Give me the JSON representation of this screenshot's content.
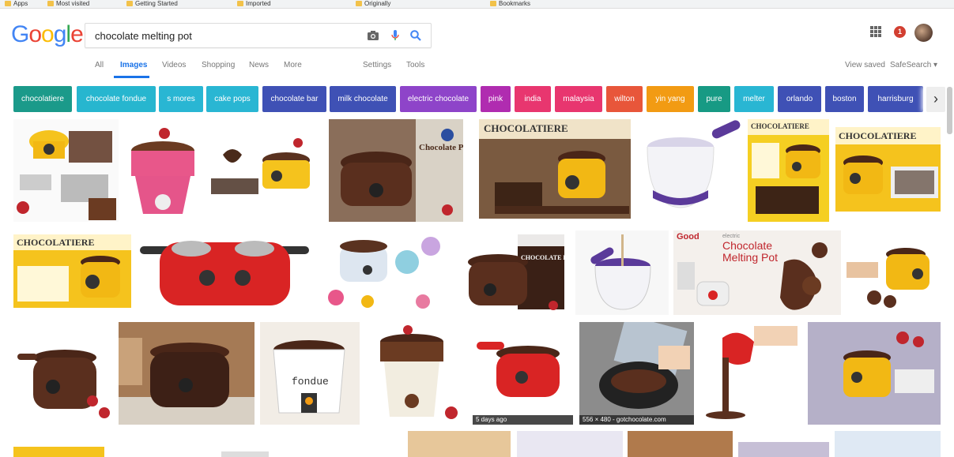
{
  "bookmarks": [
    {
      "label": "Apps"
    },
    {
      "label": "Most visited"
    },
    {
      "label": "Getting Started"
    },
    {
      "label": "Imported"
    },
    {
      "label": "Originally"
    },
    {
      "label": "Bookmarks"
    }
  ],
  "search": {
    "query": "chocolate melting pot"
  },
  "tabs": [
    {
      "label": "All"
    },
    {
      "label": "Images"
    },
    {
      "label": "Videos"
    },
    {
      "label": "Shopping"
    },
    {
      "label": "News"
    },
    {
      "label": "More"
    },
    {
      "label": "Settings"
    },
    {
      "label": "Tools"
    }
  ],
  "right_links": {
    "view_saved": "View saved",
    "safesearch": "SafeSearch ▾"
  },
  "notifications": {
    "count": "1"
  },
  "chips": [
    {
      "label": "chocolatiere",
      "color": "#1b9a8a"
    },
    {
      "label": "chocolate fondue",
      "color": "#27b6cf"
    },
    {
      "label": "s mores",
      "color": "#29b6d3"
    },
    {
      "label": "cake pops",
      "color": "#29b6d3"
    },
    {
      "label": "chocolate bar",
      "color": "#3f51b5"
    },
    {
      "label": "milk chocolate",
      "color": "#3f51b5"
    },
    {
      "label": "electric chocolate",
      "color": "#8e44c9"
    },
    {
      "label": "pink",
      "color": "#b02cb0"
    },
    {
      "label": "india",
      "color": "#e8366f"
    },
    {
      "label": "malaysia",
      "color": "#e8366f"
    },
    {
      "label": "wilton",
      "color": "#e8563a"
    },
    {
      "label": "yin yang",
      "color": "#f29b13"
    },
    {
      "label": "pure",
      "color": "#179a84"
    },
    {
      "label": "melter",
      "color": "#29b6d3"
    },
    {
      "label": "orlando",
      "color": "#3f51b5"
    },
    {
      "label": "boston",
      "color": "#3f51b5"
    },
    {
      "label": "harrisburg",
      "color": "#3f51b5"
    }
  ],
  "results": {
    "row1": [
      {
        "brand": ""
      },
      {
        "brand": ""
      },
      {
        "brand": ""
      },
      {
        "brand": "Chocolate Pro"
      },
      {
        "brand": "CHOCOLATIERE"
      },
      {
        "brand": ""
      },
      {
        "brand": "CHOCOLATIERE"
      },
      {
        "brand": "CHOCOLATIERE"
      }
    ],
    "row2": [
      {
        "brand": "CHOCOLATIERE"
      },
      {
        "brand": ""
      },
      {
        "brand": ""
      },
      {
        "brand": "CHOCOLATE PRO"
      },
      {
        "brand": ""
      },
      {
        "brand": "Chocolate Melting Pot"
      },
      {
        "brand": ""
      }
    ],
    "row3": [
      {
        "brand": ""
      },
      {
        "brand": ""
      },
      {
        "brand": "fondue"
      },
      {
        "brand": ""
      },
      {
        "brand": "",
        "label": "5 days ago"
      },
      {
        "brand": "",
        "label": "556 × 480 - gotchocolate.com"
      },
      {
        "brand": ""
      },
      {
        "brand": ""
      }
    ],
    "extra": {
      "good_brand": "Good",
      "electric": "electric"
    }
  }
}
